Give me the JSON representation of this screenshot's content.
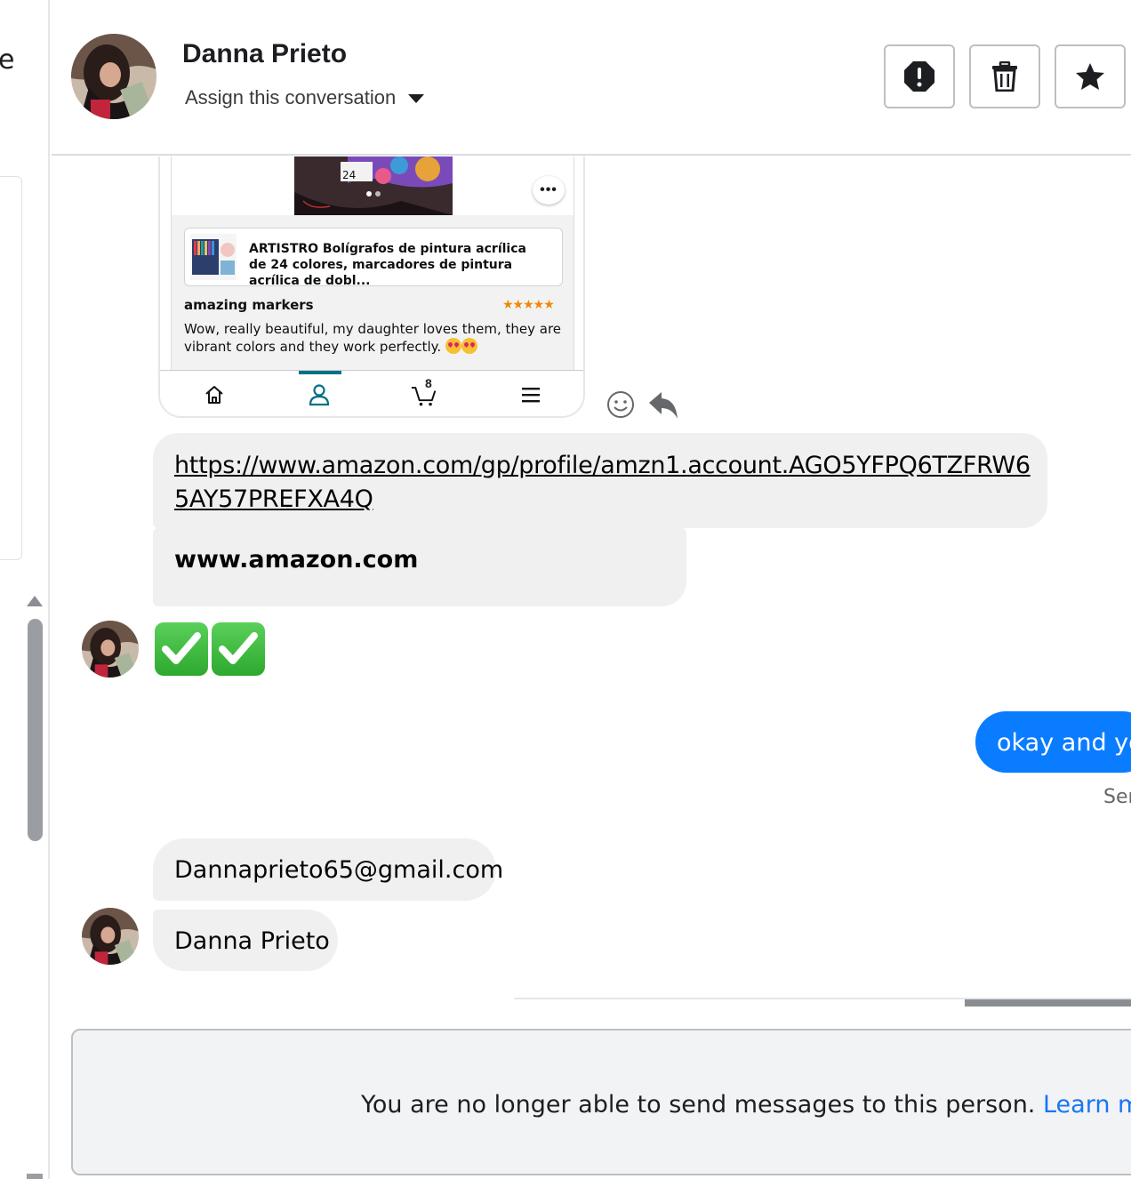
{
  "left": {
    "letter": "e"
  },
  "header": {
    "name": "Danna Prieto",
    "assign_label": "Assign this conversation"
  },
  "attachment": {
    "badge": "24",
    "product_title": "ARTISTRO Bolígrafos de pintura acrílica de 24 colores, marcadores de pintura acrílica de dobl...",
    "review_title": "amazing markers",
    "stars": "★★★★★",
    "review_text": "Wow, really beautiful, my daughter loves them, they are vibrant colors and they work perfectly.",
    "cart_count": "8"
  },
  "messages": {
    "link": "https://www.amazon.com/gp/profile/amzn1.account.AGO5YFPQ6TZFRW65AY57PREFXA4Q",
    "domain": "www.amazon.com",
    "outgoing": "okay and yo",
    "seen": "Ser",
    "email": "Dannaprieto65@gmail.com",
    "name_reply": "Danna Prieto"
  },
  "notice": {
    "text": "You are no longer able to send messages to this person. ",
    "link": "Learn more."
  },
  "colors": {
    "outgoing_bubble": "#0a7cff",
    "incoming_bubble": "#f0f0f0",
    "link_blue": "#1877f2",
    "amazon_teal": "#007185"
  },
  "icons": [
    "report-icon",
    "trash-icon",
    "star-icon",
    "home-icon",
    "account-icon",
    "cart-icon",
    "menu-icon",
    "emoji-react-icon",
    "reply-icon",
    "check-mark-emoji"
  ]
}
